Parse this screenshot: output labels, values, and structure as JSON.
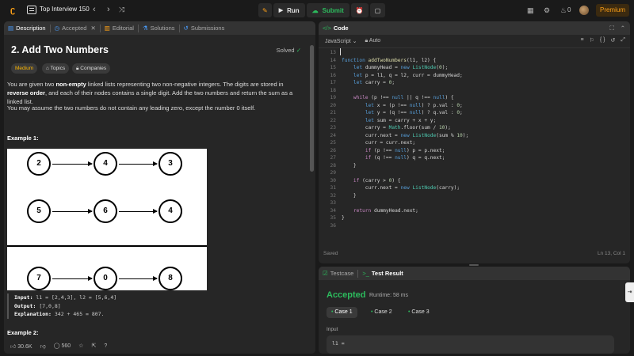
{
  "topbar": {
    "list_title": "Top Interview 150",
    "run_label": "Run",
    "submit_label": "Submit",
    "streak_count": "0",
    "premium_label": "Premium"
  },
  "description_tabs": [
    {
      "label": "Description"
    },
    {
      "label": "Accepted"
    },
    {
      "label": "Editorial"
    },
    {
      "label": "Solutions"
    },
    {
      "label": "Submissions"
    }
  ],
  "problem": {
    "title": "2. Add Two Numbers",
    "status": "Solved",
    "difficulty": "Medium",
    "topics_label": "Topics",
    "companies_label": "Companies",
    "para1_a": "You are given two ",
    "para1_b": "non-empty",
    "para1_c": " linked lists representing two non-negative integers. The digits are stored in ",
    "para1_d": "reverse order",
    "para1_e": ", and each of their nodes contains a single digit. Add the two numbers and return the sum as a linked list.",
    "para2": "You may assume the two numbers do not contain any leading zero, except the number 0 itself.",
    "example1_title": "Example 1:",
    "example2_title": "Example 2:",
    "diagram_rows": [
      [
        "2",
        "4",
        "3"
      ],
      [
        "5",
        "6",
        "4"
      ],
      [
        "7",
        "0",
        "8"
      ]
    ],
    "example1": {
      "input_label": "Input:",
      "input_value": " l1 = [2,4,3], l2 = [5,6,4]",
      "output_label": "Output:",
      "output_value": " [7,0,8]",
      "explanation_label": "Explanation:",
      "explanation_value": " 342 + 465 = 807."
    },
    "likes": "30.6K",
    "comments": "560"
  },
  "code_panel": {
    "title": "Code",
    "language": "JavaScript",
    "mode": "Auto",
    "saved_label": "Saved",
    "cursor": "Ln 13, Col 1",
    "lines": [
      {
        "n": "13",
        "t": ""
      },
      {
        "n": "14",
        "t": "function addTwoNumbers(l1, l2) {"
      },
      {
        "n": "15",
        "t": "    let dummyHead = new ListNode(0);"
      },
      {
        "n": "16",
        "t": "    let p = l1, q = l2, curr = dummyHead;"
      },
      {
        "n": "17",
        "t": "    let carry = 0;"
      },
      {
        "n": "18",
        "t": ""
      },
      {
        "n": "19",
        "t": "    while (p !== null || q !== null) {"
      },
      {
        "n": "20",
        "t": "        let x = (p !== null) ? p.val : 0;"
      },
      {
        "n": "21",
        "t": "        let y = (q !== null) ? q.val : 0;"
      },
      {
        "n": "22",
        "t": "        let sum = carry + x + y;"
      },
      {
        "n": "23",
        "t": "        carry = Math.floor(sum / 10);"
      },
      {
        "n": "24",
        "t": "        curr.next = new ListNode(sum % 10);"
      },
      {
        "n": "25",
        "t": "        curr = curr.next;"
      },
      {
        "n": "26",
        "t": "        if (p !== null) p = p.next;"
      },
      {
        "n": "27",
        "t": "        if (q !== null) q = q.next;"
      },
      {
        "n": "28",
        "t": "    }"
      },
      {
        "n": "29",
        "t": ""
      },
      {
        "n": "30",
        "t": "    if (carry > 0) {"
      },
      {
        "n": "31",
        "t": "        curr.next = new ListNode(carry);"
      },
      {
        "n": "32",
        "t": "    }"
      },
      {
        "n": "33",
        "t": ""
      },
      {
        "n": "34",
        "t": "    return dummyHead.next;"
      },
      {
        "n": "35",
        "t": "}"
      },
      {
        "n": "36",
        "t": ""
      }
    ]
  },
  "test_panel": {
    "tab_testcase": "Testcase",
    "tab_result": "Test Result",
    "status": "Accepted",
    "runtime": "Runtime: 58 ms",
    "cases": [
      "Case 1",
      "Case 2",
      "Case 3"
    ],
    "input_label": "Input",
    "input_value": "l1 ="
  }
}
